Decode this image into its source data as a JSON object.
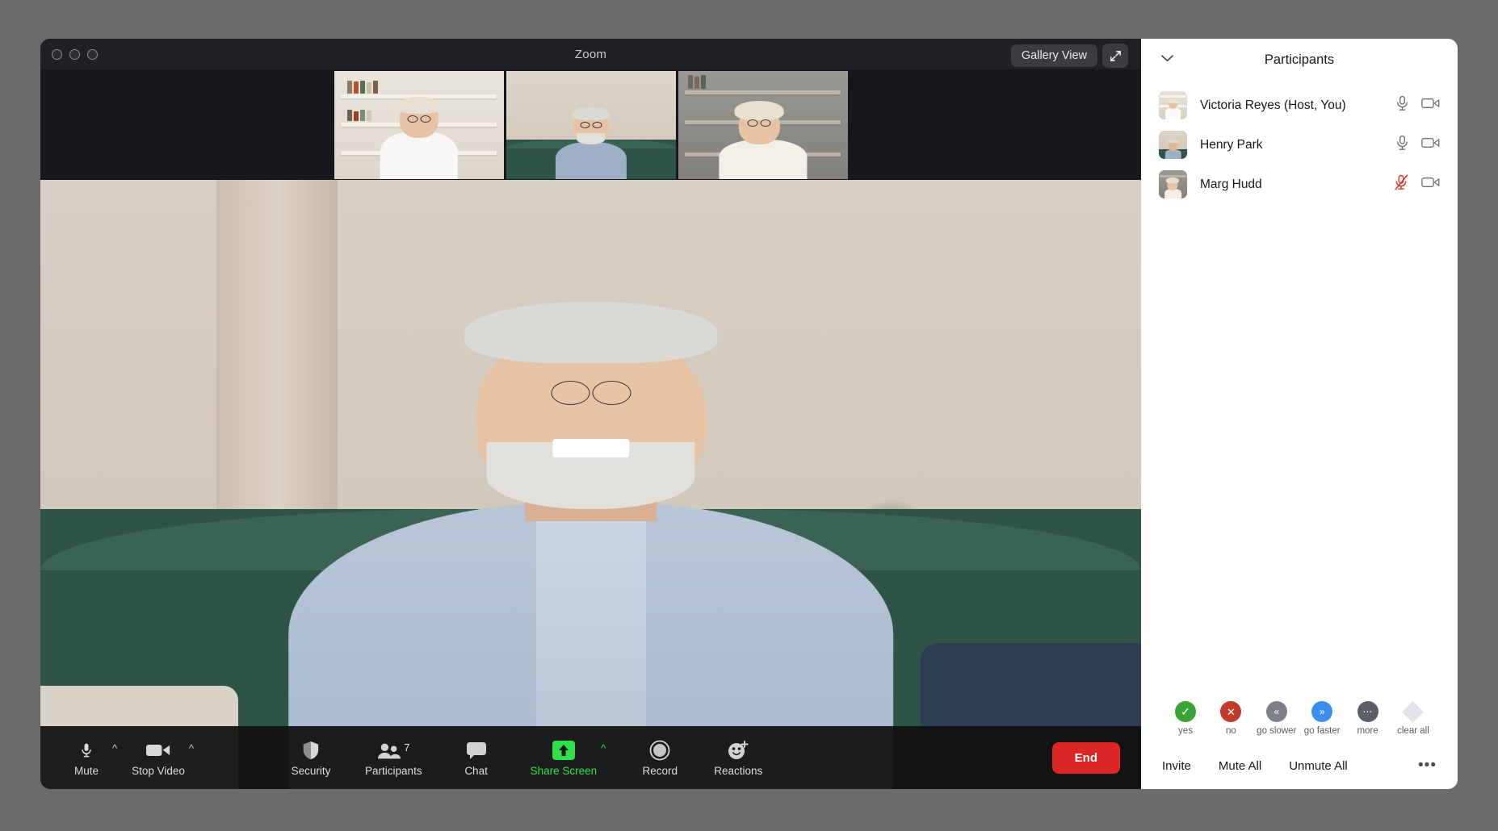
{
  "window": {
    "title": "Zoom",
    "traffic_lights": [
      "close",
      "minimize",
      "maximize"
    ]
  },
  "video_header": {
    "gallery_view_label": "Gallery View",
    "expand_icon": "expand-icon"
  },
  "filmstrip": [
    {
      "name": "Victoria Reyes",
      "active": false
    },
    {
      "name": "Henry Park",
      "active": true
    },
    {
      "name": "Marg Hudd",
      "active": false
    }
  ],
  "main_speaker": {
    "name": "Henry Park"
  },
  "toolbar": {
    "left": [
      {
        "label": "Mute",
        "icon": "microphone-icon",
        "caret": true
      },
      {
        "label": "Stop Video",
        "icon": "video-camera-icon",
        "caret": true
      }
    ],
    "center": [
      {
        "label": "Security",
        "icon": "shield-icon",
        "caret": false,
        "badge": ""
      },
      {
        "label": "Participants",
        "icon": "people-icon",
        "caret": false,
        "badge": "7"
      },
      {
        "label": "Chat",
        "icon": "chat-bubble-icon",
        "caret": false,
        "badge": ""
      },
      {
        "label": "Share Screen",
        "icon": "share-screen-icon",
        "caret": true,
        "badge": "",
        "highlight": "#2fe04a"
      },
      {
        "label": "Record",
        "icon": "record-icon",
        "caret": false,
        "badge": ""
      },
      {
        "label": "Reactions",
        "icon": "reactions-icon",
        "caret": false,
        "badge": ""
      }
    ],
    "end_label": "End",
    "end_color": "#dc2626"
  },
  "participants_panel": {
    "title": "Participants",
    "collapse_icon": "chevron-down-icon",
    "list": [
      {
        "name": "Victoria Reyes (Host, You)",
        "mic": "mic-on",
        "video": "video-on"
      },
      {
        "name": "Henry Park",
        "mic": "mic-on",
        "video": "video-on"
      },
      {
        "name": "Marg Hudd",
        "mic": "mic-muted",
        "video": "video-on"
      }
    ],
    "reactions": [
      {
        "label": "yes",
        "icon": "check-circle-icon",
        "color": "#3aa335"
      },
      {
        "label": "no",
        "icon": "x-circle-icon",
        "color": "#c0392b"
      },
      {
        "label": "go slower",
        "icon": "double-chevron-left-icon",
        "color": "#7c8089"
      },
      {
        "label": "go faster",
        "icon": "double-chevron-right-icon",
        "color": "#3b8ef0"
      },
      {
        "label": "more",
        "icon": "ellipsis-circle-icon",
        "color": "#5a5e66"
      },
      {
        "label": "clear all",
        "icon": "diamond-icon",
        "color": "#e2e5e8"
      }
    ],
    "actions": [
      {
        "label": "Invite"
      },
      {
        "label": "Mute All"
      },
      {
        "label": "Unmute All"
      }
    ],
    "more_label": "•••"
  }
}
